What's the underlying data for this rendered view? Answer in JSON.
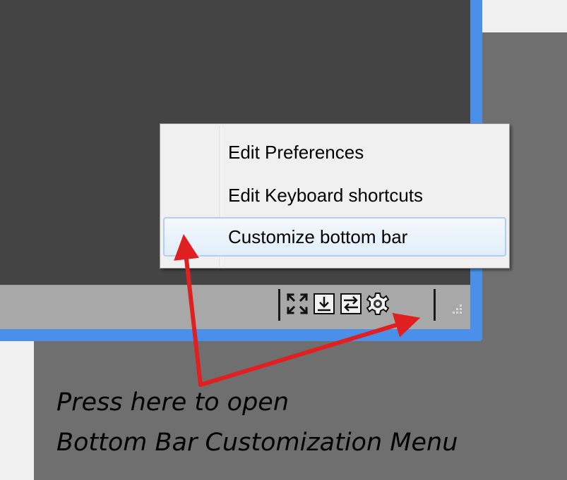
{
  "context_menu": {
    "items": [
      {
        "label": "Edit Preferences",
        "highlighted": false
      },
      {
        "label": "Edit Keyboard shortcuts",
        "highlighted": false
      },
      {
        "label": "Customize bottom bar",
        "highlighted": true
      }
    ]
  },
  "bottom_bar": {
    "icons": [
      "fullscreen-icon",
      "download-icon",
      "swap-icon",
      "gear-icon"
    ]
  },
  "annotation": {
    "line1": "Press here to open",
    "line2": "Bottom Bar Customization Menu",
    "arrow_color": "#e02020"
  },
  "colors": {
    "viewport": "#444444",
    "window_border": "#4a90e8",
    "bottom_bar": "#a8a8a8",
    "menu_highlight_border": "#aecff7"
  }
}
